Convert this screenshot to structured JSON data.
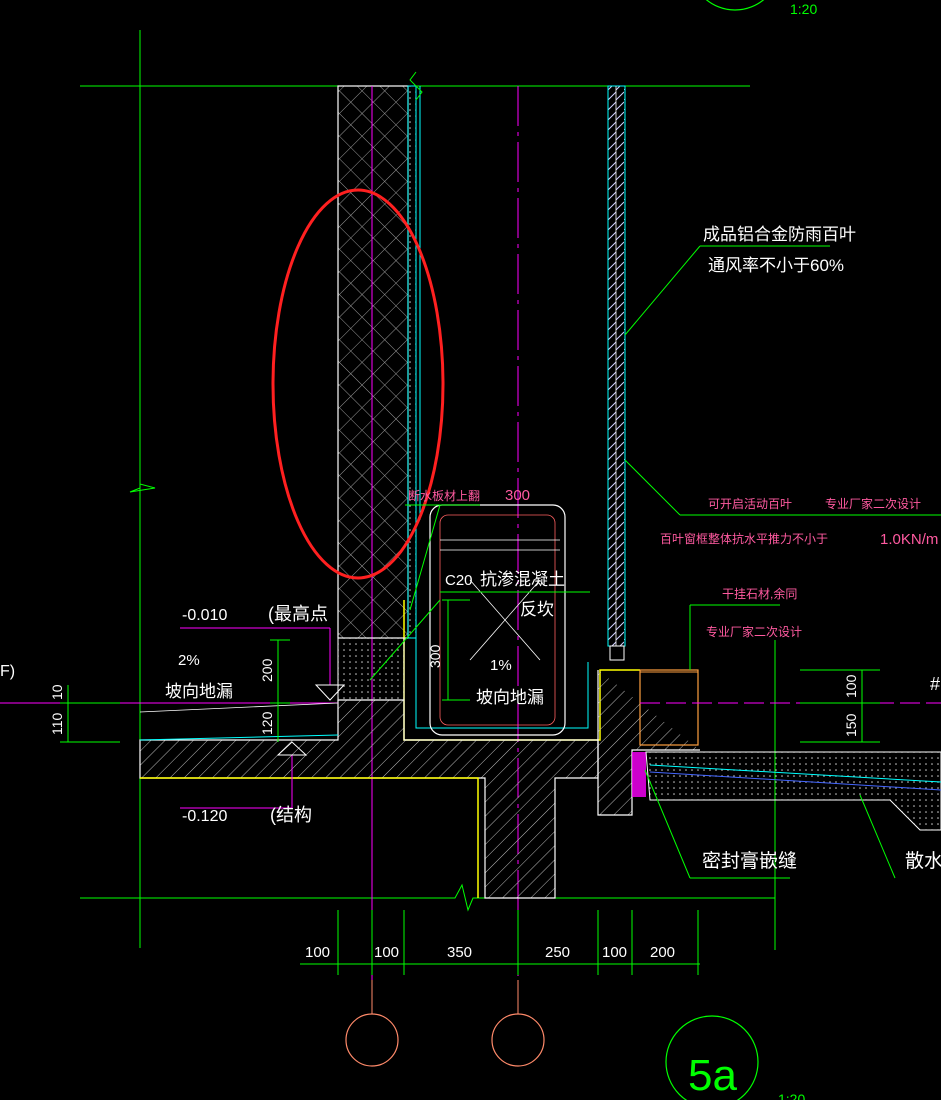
{
  "top_scale": "1:20",
  "detail": {
    "id": "5a",
    "scale": "1:20"
  },
  "annotations": {
    "louver_1": "成品铝合金防雨百叶",
    "louver_2": "通风率不小于60%",
    "openable": "可开启活动百叶",
    "vendor_design": "专业厂家二次设计",
    "wind_load": "百叶窗框整体抗水平推力不小于",
    "wind_value": "1.0KN/m",
    "stone": "干挂石材,余同",
    "vendor_design_2": "专业厂家二次设计",
    "sealant": "密封膏嵌缝",
    "apron": "散水",
    "dim_300_top": "300",
    "broken_text": "断水板材上翻",
    "c20": "C20",
    "concrete": "抗渗混凝土",
    "upturn": "反坎",
    "slope_1pct": "1%",
    "slope_drain_right": "坡向地漏",
    "elev_top": "-0.010",
    "elev_top_note": "(最高点",
    "slope_2pct": "2%",
    "slope_drain_left": "坡向地漏",
    "elev_bottom": "-0.120",
    "elev_bottom_note": "(结构",
    "left_edge": "F)",
    "right_edge": "#"
  },
  "dims": {
    "left_10": "10",
    "left_110": "110",
    "mid_200": "200",
    "mid_120": "120",
    "pit_300": "300",
    "right_100": "100",
    "right_150": "150",
    "bottom": [
      "100",
      "100",
      "350",
      "250",
      "100",
      "200"
    ]
  },
  "colors": {
    "background": "#000000",
    "green": "#00ff00",
    "cyan": "#00ffff",
    "magenta": "#ff00ff",
    "red": "#ff2020",
    "yellow": "#ffff00",
    "white": "#ffffff",
    "salmon": "#ff8a6a",
    "label_pink": "#ff5aa0",
    "blue": "#4466ff"
  }
}
